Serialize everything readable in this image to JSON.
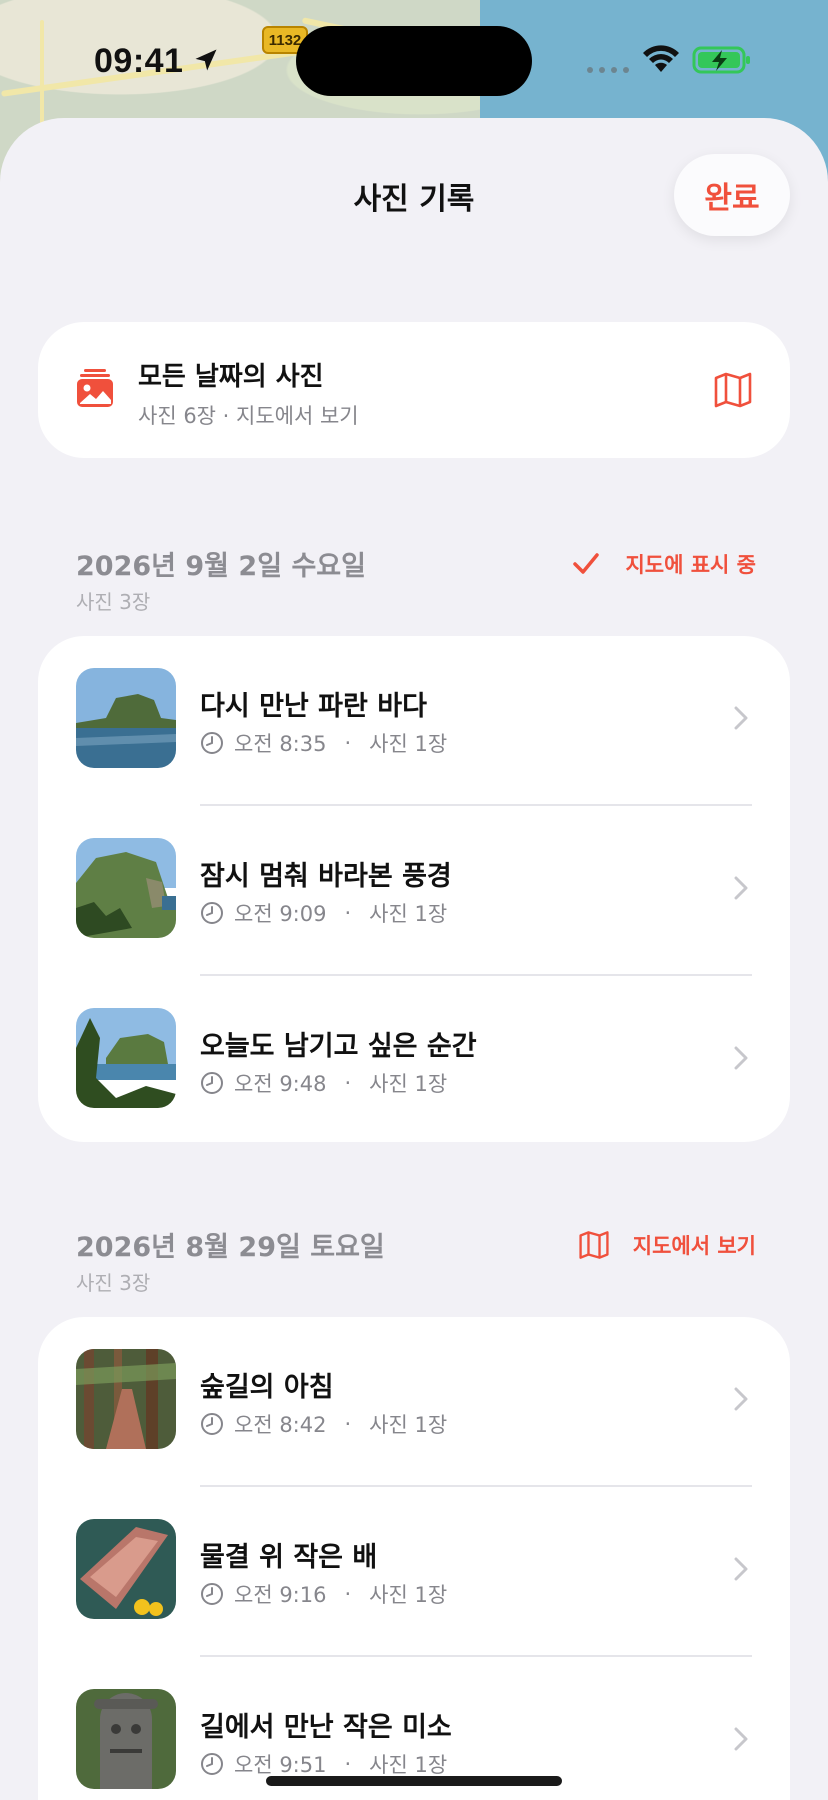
{
  "status": {
    "time": "09:41"
  },
  "map": {
    "road_badge": "1132"
  },
  "header": {
    "title": "사진 기록",
    "done_label": "완료"
  },
  "all_photos": {
    "title": "모든 날짜의 사진",
    "subtitle": "사진 6장 · 지도에서 보기",
    "icon": "photo-stack-icon",
    "action_icon": "map-icon"
  },
  "sections": [
    {
      "date": "2026년 9월 2일 수요일",
      "count": "사진 3장",
      "action_label": "지도에 표시 중",
      "action_icon": "checkmark-icon",
      "items": [
        {
          "title": "다시 만난 파란 바다",
          "time": "오전 8:35",
          "photos": "사진 1장"
        },
        {
          "title": "잠시 멈춰 바라본 풍경",
          "time": "오전 9:09",
          "photos": "사진 1장"
        },
        {
          "title": "오늘도 남기고 싶은 순간",
          "time": "오전 9:48",
          "photos": "사진 1장"
        }
      ]
    },
    {
      "date": "2026년 8월 29일 토요일",
      "count": "사진 3장",
      "action_label": "지도에서 보기",
      "action_icon": "map-icon",
      "items": [
        {
          "title": "숲길의 아침",
          "time": "오전 8:42",
          "photos": "사진 1장"
        },
        {
          "title": "물결 위 작은 배",
          "time": "오전 9:16",
          "photos": "사진 1장"
        },
        {
          "title": "길에서 만난 작은 미소",
          "time": "오전 9:51",
          "photos": "사진 1장"
        }
      ]
    }
  ],
  "colors": {
    "accent": "#f0503c",
    "background": "#f2f1f6",
    "secondary_text": "#86868c"
  }
}
